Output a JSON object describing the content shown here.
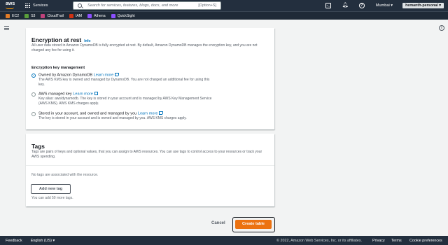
{
  "topnav": {
    "logo": "aws",
    "services_label": "Services",
    "search_placeholder": "Search for services, features, blogs, docs, and more",
    "search_shortcut": "[Option+S]",
    "region": "Mumbai ▾",
    "account": "hemanth-personal ▾"
  },
  "favorites": [
    {
      "label": "EC2",
      "color": "#e07b27"
    },
    {
      "label": "S3",
      "color": "#5a9e3a"
    },
    {
      "label": "CloudTrail",
      "color": "#c0427b"
    },
    {
      "label": "IAM",
      "color": "#d13212"
    },
    {
      "label": "Athena",
      "color": "#8c4fff"
    },
    {
      "label": "QuickSight",
      "color": "#8c4fff"
    }
  ],
  "encryption": {
    "title": "Encryption at rest",
    "info": "Info",
    "desc": "All user data stored in Amazon DynamoDB is fully encrypted at rest. By default, Amazon DynamoDB manages the encryption key, and you are not charged any fee for using it.",
    "section_label": "Encryption key management",
    "options": [
      {
        "label": "Owned by Amazon DynamoDB",
        "learn": "Learn more",
        "desc": "The AWS KMS key is owned and managed by DynamoDB. You are not charged an additional fee for using this key.",
        "checked": true
      },
      {
        "label": "AWS managed key",
        "learn": "Learn more",
        "desc": "Key alias: aws/dynamodb. The key is stored in your account and is managed by AWS Key Management Service (AWS KMS). AWS KMS charges apply.",
        "checked": false
      },
      {
        "label": "Stored in your account, and owned and managed by you",
        "learn": "Learn more",
        "desc": "The key is stored in your account and is owned and managed by you. AWS KMS charges apply.",
        "checked": false
      }
    ]
  },
  "tags": {
    "title": "Tags",
    "desc": "Tags are pairs of keys and optional values, that you can assign to AWS resources. You can use tags to control access to your resources or track your AWS spending.",
    "no_tags": "No tags are associated with the resource.",
    "add_button": "Add new tag",
    "hint": "You can add 50 more tags."
  },
  "actions": {
    "cancel": "Cancel",
    "create": "Create table"
  },
  "footer": {
    "feedback": "Feedback",
    "language": "English (US) ▾",
    "copyright": "© 2022, Amazon Web Services, Inc. or its affiliates.",
    "privacy": "Privacy",
    "terms": "Terms",
    "cookies": "Cookie preferences"
  }
}
